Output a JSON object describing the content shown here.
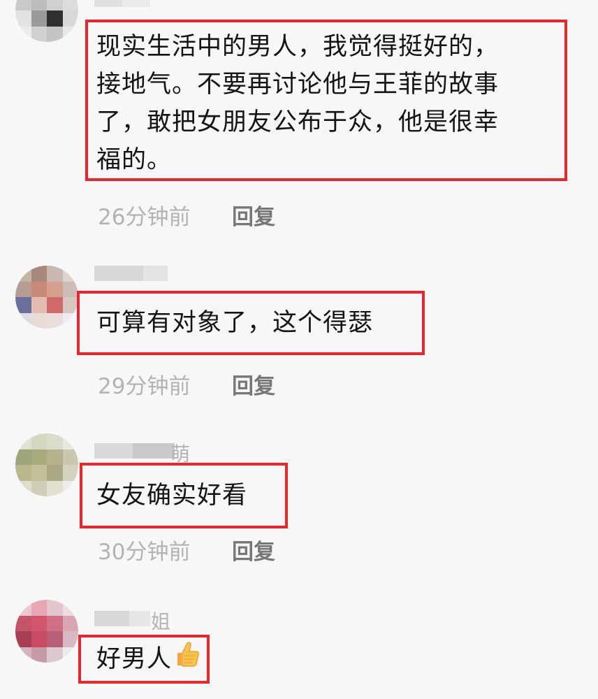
{
  "comments": [
    {
      "text": "现实生活中的男人，我觉得挺好的，接地气。不要再讨论他与王菲的故事了，敢把女朋友公布于众，他是很幸福的。",
      "lines": [
        "现实生活中的男人，我觉得挺好的，",
        "接地气。不要再讨论他与王菲的故事",
        "了，敢把女朋友公布于众，他是很幸",
        "福的。"
      ],
      "time": "26分钟前",
      "reply": "回复"
    },
    {
      "username_suffix": "",
      "text": "可算有对象了，这个得瑟",
      "time": "29分钟前",
      "reply": "回复"
    },
    {
      "username_suffix": "萌",
      "text": "女友确实好看",
      "time": "30分钟前",
      "reply": "回复"
    },
    {
      "username_suffix": "姐",
      "text": "好男人",
      "emoji": "thumbs-up-icon"
    }
  ],
  "colors": {
    "highlight": "#e8262b",
    "text": "#141414",
    "time": "#b3b3b3",
    "reply": "#777777",
    "background": "#f7f7f7"
  }
}
